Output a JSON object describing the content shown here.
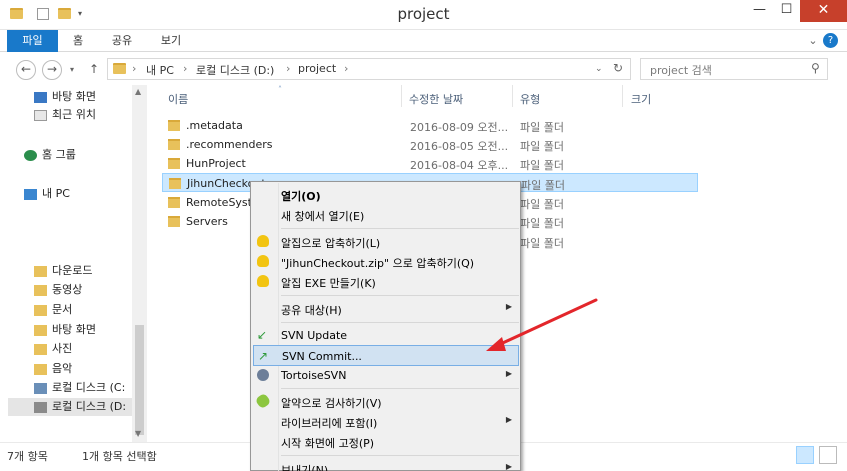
{
  "window": {
    "title": "project"
  },
  "ribbon": {
    "tabs": [
      "파일",
      "홈",
      "공유",
      "보기"
    ]
  },
  "address": {
    "crumbs": [
      "내 PC",
      "로컬 디스크 (D:)",
      "project"
    ],
    "search_placeholder": "project 검색"
  },
  "nav": {
    "items": [
      {
        "label": "바탕 화면",
        "icon": "desktop-icon"
      },
      {
        "label": "최근 위치",
        "icon": "recent-icon"
      },
      {
        "label": "홈 그룹",
        "icon": "homegroup-icon"
      },
      {
        "label": "내 PC",
        "icon": "computer-icon"
      },
      {
        "label": "다운로드",
        "icon": "downloads-icon"
      },
      {
        "label": "동영상",
        "icon": "videos-icon"
      },
      {
        "label": "문서",
        "icon": "documents-icon"
      },
      {
        "label": "바탕 화면",
        "icon": "desktop-folder-icon"
      },
      {
        "label": "사진",
        "icon": "pictures-icon"
      },
      {
        "label": "음악",
        "icon": "music-icon"
      },
      {
        "label": "로컬 디스크 (C:",
        "icon": "drive-c-icon"
      },
      {
        "label": "로컬 디스크 (D:",
        "icon": "drive-d-icon"
      }
    ]
  },
  "columns": {
    "name": "이름",
    "date": "수정한 날짜",
    "type": "유형",
    "size": "크기"
  },
  "files": [
    {
      "name": ".metadata",
      "date": "2016-08-09 오전...",
      "type": "파일 폴더"
    },
    {
      "name": ".recommenders",
      "date": "2016-08-05 오전...",
      "type": "파일 폴더"
    },
    {
      "name": "HunProject",
      "date": "2016-08-04 오후...",
      "type": "파일 폴더"
    },
    {
      "name": "JihunCheckout",
      "date": "",
      "type": "파일 폴더"
    },
    {
      "name": "RemoteSyste",
      "date": "",
      "type": "파일 폴더"
    },
    {
      "name": "Servers",
      "date": "",
      "type": "파일 폴더"
    },
    {
      "name": "",
      "date": "",
      "type": "파일 폴더"
    }
  ],
  "status": {
    "count": "7개 항목",
    "selected": "1개 항목 선택함"
  },
  "context_menu": {
    "items": [
      {
        "label": "열기(O)",
        "icon": "",
        "bold": true
      },
      {
        "label": "새 창에서 열기(E)",
        "icon": ""
      },
      {
        "label": "알집으로 압축하기(L)",
        "icon": "alzip-icon"
      },
      {
        "label": "\"JihunCheckout.zip\" 으로 압축하기(Q)",
        "icon": "alzip-icon"
      },
      {
        "label": "알집 EXE 만들기(K)",
        "icon": "alzip-icon"
      },
      {
        "label": "공유 대상(H)",
        "icon": "",
        "submenu": true
      },
      {
        "label": "SVN Update",
        "icon": "svn-update-icon"
      },
      {
        "label": "SVN Commit...",
        "icon": "svn-commit-icon"
      },
      {
        "label": "TortoiseSVN",
        "icon": "tortoisesvn-icon",
        "submenu": true
      },
      {
        "label": "알약으로 검사하기(V)",
        "icon": "alyac-icon"
      },
      {
        "label": "라이브러리에 포함(I)",
        "icon": "",
        "submenu": true
      },
      {
        "label": "시작 화면에 고정(P)",
        "icon": ""
      },
      {
        "label": "보내기(N)",
        "icon": "",
        "submenu": true
      }
    ]
  },
  "colors": {
    "accent": "#1979ca",
    "close": "#c7402b",
    "selection": "#cce8ff",
    "menu_highlight": "#d1e2f2",
    "arrow": "#e3262b"
  }
}
